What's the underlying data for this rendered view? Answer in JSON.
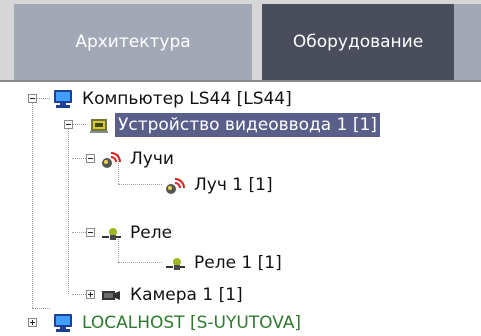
{
  "tabs": [
    {
      "label": "Архитектура",
      "active": false
    },
    {
      "label": "Оборудование",
      "active": true
    }
  ],
  "tree": {
    "computer": {
      "label": "Компьютер LS44 [LS44]",
      "icon": "computer-icon",
      "expanded": true
    },
    "video_device": {
      "label": "Устройство видеоввода 1 [1]",
      "icon": "video-capture-board-icon",
      "expanded": true,
      "selected": true
    },
    "rays_group": {
      "label": "Лучи",
      "icon": "ray-sensor-icon",
      "expanded": true
    },
    "ray_1": {
      "label": "Луч 1 [1]",
      "icon": "ray-sensor-icon"
    },
    "relays_group": {
      "label": "Реле",
      "icon": "relay-icon",
      "expanded": true
    },
    "relay_1": {
      "label": "Реле 1 [1]",
      "icon": "relay-icon"
    },
    "camera_1": {
      "label": "Камера 1 [1]",
      "icon": "camera-icon",
      "expanded": false
    },
    "localhost": {
      "label": "LOCALHOST [S-UYUTOVA]",
      "icon": "computer-icon",
      "expanded": false
    }
  },
  "colors": {
    "tab_active": "#4a4d5c",
    "tab_inactive": "#a3a8b6",
    "selection": "#5a5f8a",
    "localhost_text": "#2e7a2e"
  }
}
